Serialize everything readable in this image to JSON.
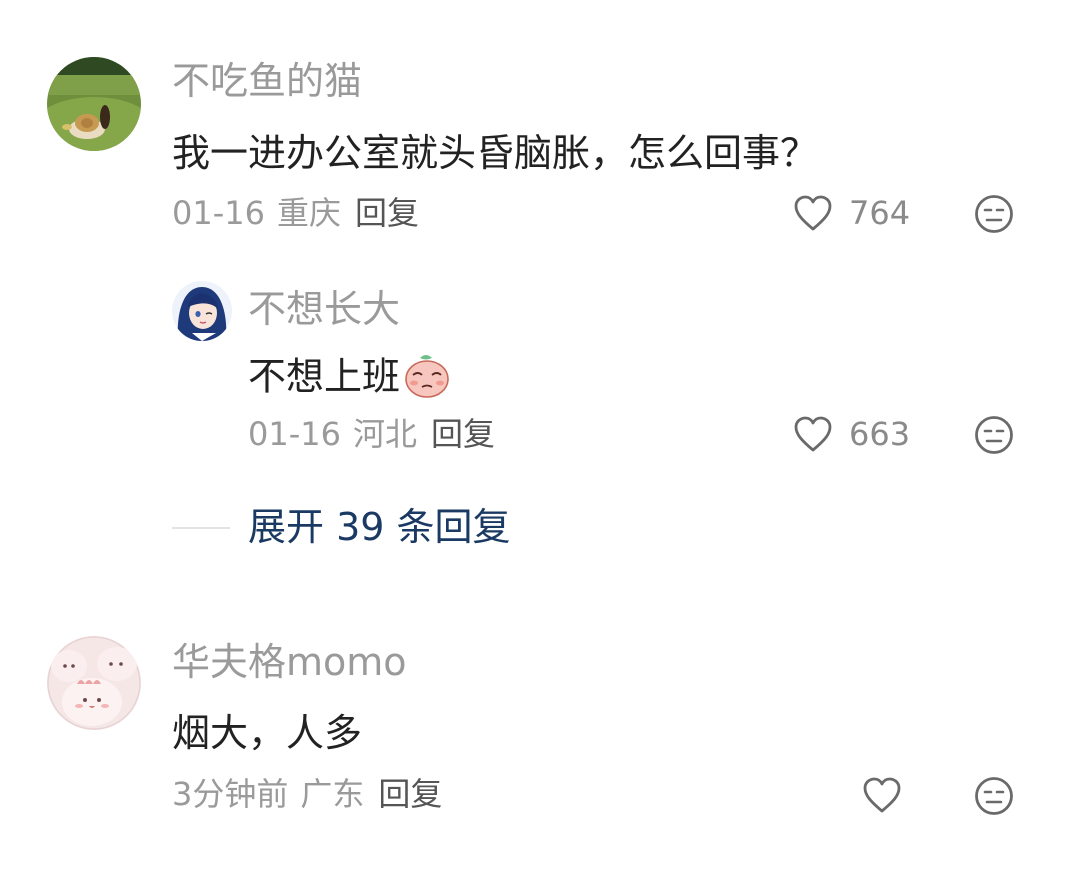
{
  "comments": [
    {
      "username": "不吃鱼的猫",
      "text": "我一进办公室就头昏脑胀，怎么回事？",
      "date": "01-16",
      "location": "重庆",
      "reply_label": "回复",
      "likes": "764",
      "avatar_icon": "cat-hat-grass-avatar",
      "replies": [
        {
          "username": "不想长大",
          "text": "不想上班",
          "emoji": "peach-sticker-icon",
          "date": "01-16",
          "location": "河北",
          "reply_label": "回复",
          "likes": "663",
          "avatar_icon": "anime-girl-avatar"
        }
      ],
      "expand_label": "展开 39 条回复"
    },
    {
      "username": "华夫格momo",
      "text": "烟大，人多",
      "date": "3分钟前",
      "location": "广东",
      "reply_label": "回复",
      "likes": "",
      "avatar_icon": "pink-blob-avatar"
    }
  ],
  "colors": {
    "username": "#9a9a9a",
    "text": "#222222",
    "meta": "#9a9a9a",
    "expand": "#1b3a63"
  }
}
